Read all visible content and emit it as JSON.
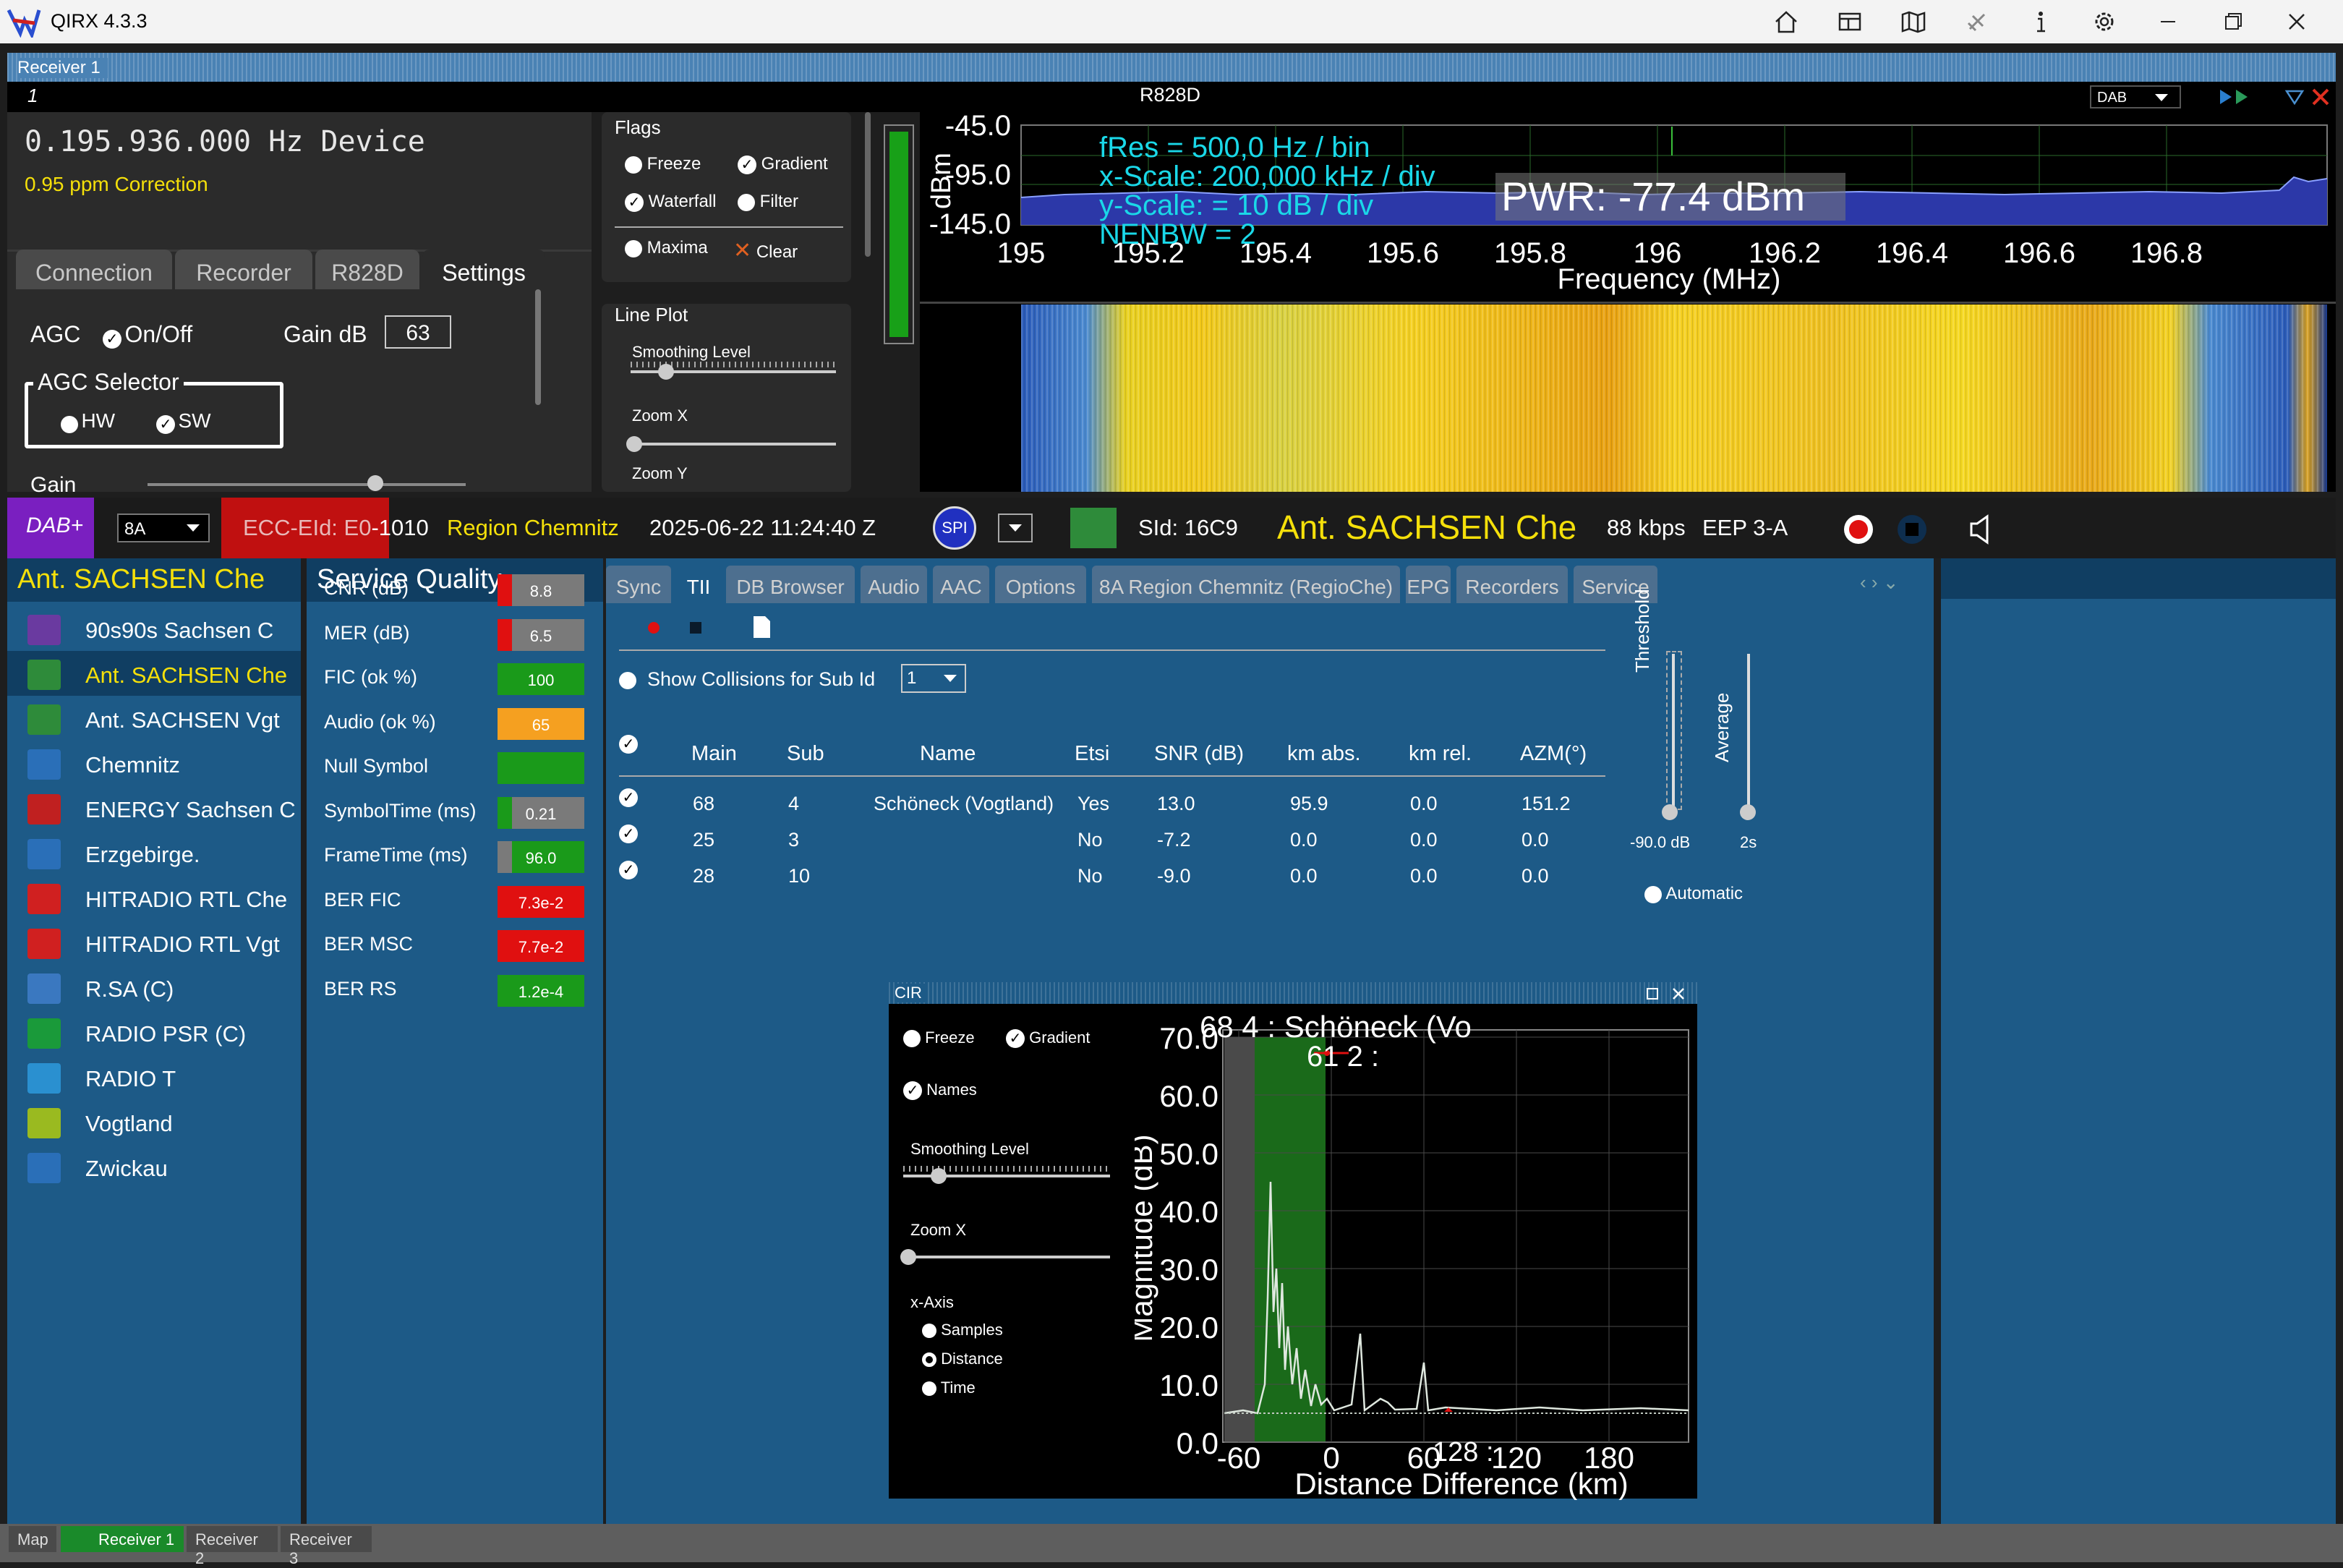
{
  "window": {
    "title": "QIRX 4.3.3"
  },
  "receiver": {
    "label": "Receiver 1",
    "index": "1",
    "device_name": "R828D",
    "mode_select": "DAB"
  },
  "tuner": {
    "frequency": "0.195.936.000 Hz Device",
    "correction": "0.95 ppm Correction"
  },
  "left_tabs": [
    "Connection",
    "Recorder",
    "R828D",
    "Settings"
  ],
  "settings": {
    "agc_label": "AGC",
    "agc_onoff": "On/Off",
    "gain_db_label": "Gain dB",
    "gain_db_value": "63",
    "agc_selector": "AGC Selector",
    "hw": "HW",
    "sw": "SW",
    "gain_label": "Gain"
  },
  "flags": {
    "title": "Flags",
    "freeze": "Freeze",
    "gradient": "Gradient",
    "waterfall": "Waterfall",
    "filter": "Filter",
    "maxima": "Maxima",
    "clear": "Clear"
  },
  "lineplot": {
    "title": "Line Plot",
    "smoothing": "Smoothing Level",
    "zoomx": "Zoom X",
    "zoomy": "Zoom Y"
  },
  "spectrum": {
    "y_ticks": [
      "-45.0",
      "-95.0",
      "-145.0"
    ],
    "ylabel": "dBm",
    "x_ticks": [
      "195",
      "195.2",
      "195.4",
      "195.6",
      "195.8",
      "196",
      "196.2",
      "196.4",
      "196.6",
      "196.8"
    ],
    "xlabel": "Frequency (MHz)",
    "info": [
      "fRes = 500,0 Hz / bin",
      "x-Scale: 200,000 kHz / div",
      "y-Scale: = 10 dB / div",
      "NENBW = 2"
    ],
    "pwr": "PWR: -77.4 dBm"
  },
  "mid": {
    "mode": "DAB+",
    "channel": "8A",
    "ecc_prefix": "ECC-EId: E0",
    "ecc_suffix": "-1010",
    "region": "Region Chemnitz",
    "datetime": "2025-06-22  11:24:40 Z",
    "spi": "SPI",
    "sid": "SId: 16C9",
    "service": "Ant. SACHSEN Che",
    "bitrate": "88 kbps",
    "eep": "EEP 3-A"
  },
  "services": {
    "header": "Ant. SACHSEN Che",
    "items": [
      {
        "label": "90s90s Sachsen C",
        "color": "#6a3aa0"
      },
      {
        "label": "Ant. SACHSEN Che",
        "color": "#2e8b3a",
        "selected": true
      },
      {
        "label": "Ant. SACHSEN Vgt",
        "color": "#2e8b3a"
      },
      {
        "label": "Chemnitz",
        "color": "#2a6fb8"
      },
      {
        "label": "ENERGY Sachsen C",
        "color": "#c02020"
      },
      {
        "label": "Erzgebirge.",
        "color": "#2a6fb8"
      },
      {
        "label": "HITRADIO RTL Che",
        "color": "#d02020"
      },
      {
        "label": "HITRADIO RTL Vgt",
        "color": "#d02020"
      },
      {
        "label": "R.SA (C)",
        "color": "#3a78c0"
      },
      {
        "label": "RADIO PSR (C)",
        "color": "#1a9a3a"
      },
      {
        "label": "RADIO T",
        "color": "#2a90d0"
      },
      {
        "label": "Vogtland",
        "color": "#9aba20"
      },
      {
        "label": "Zwickau",
        "color": "#2a6fb8"
      }
    ]
  },
  "quality": {
    "header": "Service Quality",
    "rows": [
      {
        "label": "CNR (dB)",
        "value": "8.8",
        "color": "#7a7a7a",
        "flag": "#e01010"
      },
      {
        "label": "MER (dB)",
        "value": "6.5",
        "color": "#7a7a7a",
        "flag": "#e01010"
      },
      {
        "label": "FIC (ok %)",
        "value": "100",
        "color": "#1a9a1a"
      },
      {
        "label": "Audio (ok %)",
        "value": "65",
        "color": "#f5a020",
        "flag": "#f5a020"
      },
      {
        "label": "Null Symbol",
        "value": "",
        "color": "#1a9a1a"
      },
      {
        "label": "SymbolTime (ms)",
        "value": "0.21",
        "color": "#7a7a7a",
        "flag": "#1a9a1a"
      },
      {
        "label": "FrameTime (ms)",
        "value": "96.0",
        "color": "#1a9a1a",
        "flag": "#7a7a7a"
      },
      {
        "label": "BER FIC",
        "value": "7.3e-2",
        "color": "#e01010"
      },
      {
        "label": "BER MSC",
        "value": "7.7e-2",
        "color": "#e01010"
      },
      {
        "label": "BER RS",
        "value": "1.2e-4",
        "color": "#1a9a1a"
      }
    ]
  },
  "tii_tabs": [
    "Sync",
    "TII",
    "DB Browser",
    "Audio",
    "AAC",
    "Options",
    "8A Region Chemnitz (RegioChe)",
    "EPG",
    "Recorders",
    "Service"
  ],
  "tii": {
    "show_collisions": "Show Collisions for Sub Id",
    "subid": "1",
    "headers": [
      "Main",
      "Sub",
      "Name",
      "Etsi",
      "SNR (dB)",
      "km abs.",
      "km rel.",
      "AZM(°)"
    ],
    "rows": [
      [
        "68",
        "4",
        "Schöneck (Vogtland)",
        "Yes",
        "13.0",
        "95.9",
        "0.0",
        "151.2"
      ],
      [
        "25",
        "3",
        "",
        "No",
        "-7.2",
        "0.0",
        "0.0",
        "0.0"
      ],
      [
        "28",
        "10",
        "",
        "No",
        "-9.0",
        "0.0",
        "0.0",
        "0.0"
      ]
    ],
    "threshold": "Threshold",
    "threshold_val": "-90.0 dB",
    "average": "Average",
    "average_val": "2s",
    "automatic": "Automatic"
  },
  "cir": {
    "title": "CIR",
    "freeze": "Freeze",
    "gradient": "Gradient",
    "names": "Names",
    "smoothing": "Smoothing Level",
    "zoomx": "Zoom X",
    "xaxis": "x-Axis",
    "samples": "Samples",
    "distance": "Distance",
    "time": "Time",
    "y_ticks": [
      "70.0",
      "60.0",
      "50.0",
      "40.0",
      "30.0",
      "20.0",
      "10.0",
      "0.0"
    ],
    "x_ticks": [
      "-60",
      "0",
      "60",
      "120",
      "180"
    ],
    "xlabel": "Distance Difference (km)",
    "ylabel": "Magnitude (dB)",
    "annot1": "68 4 : Schöneck (Vo",
    "annot2": "61 2 :",
    "annot3": "128 :"
  },
  "bottom_tabs": [
    "Map",
    "Receiver 1",
    "Receiver 2",
    "Receiver 3"
  ]
}
